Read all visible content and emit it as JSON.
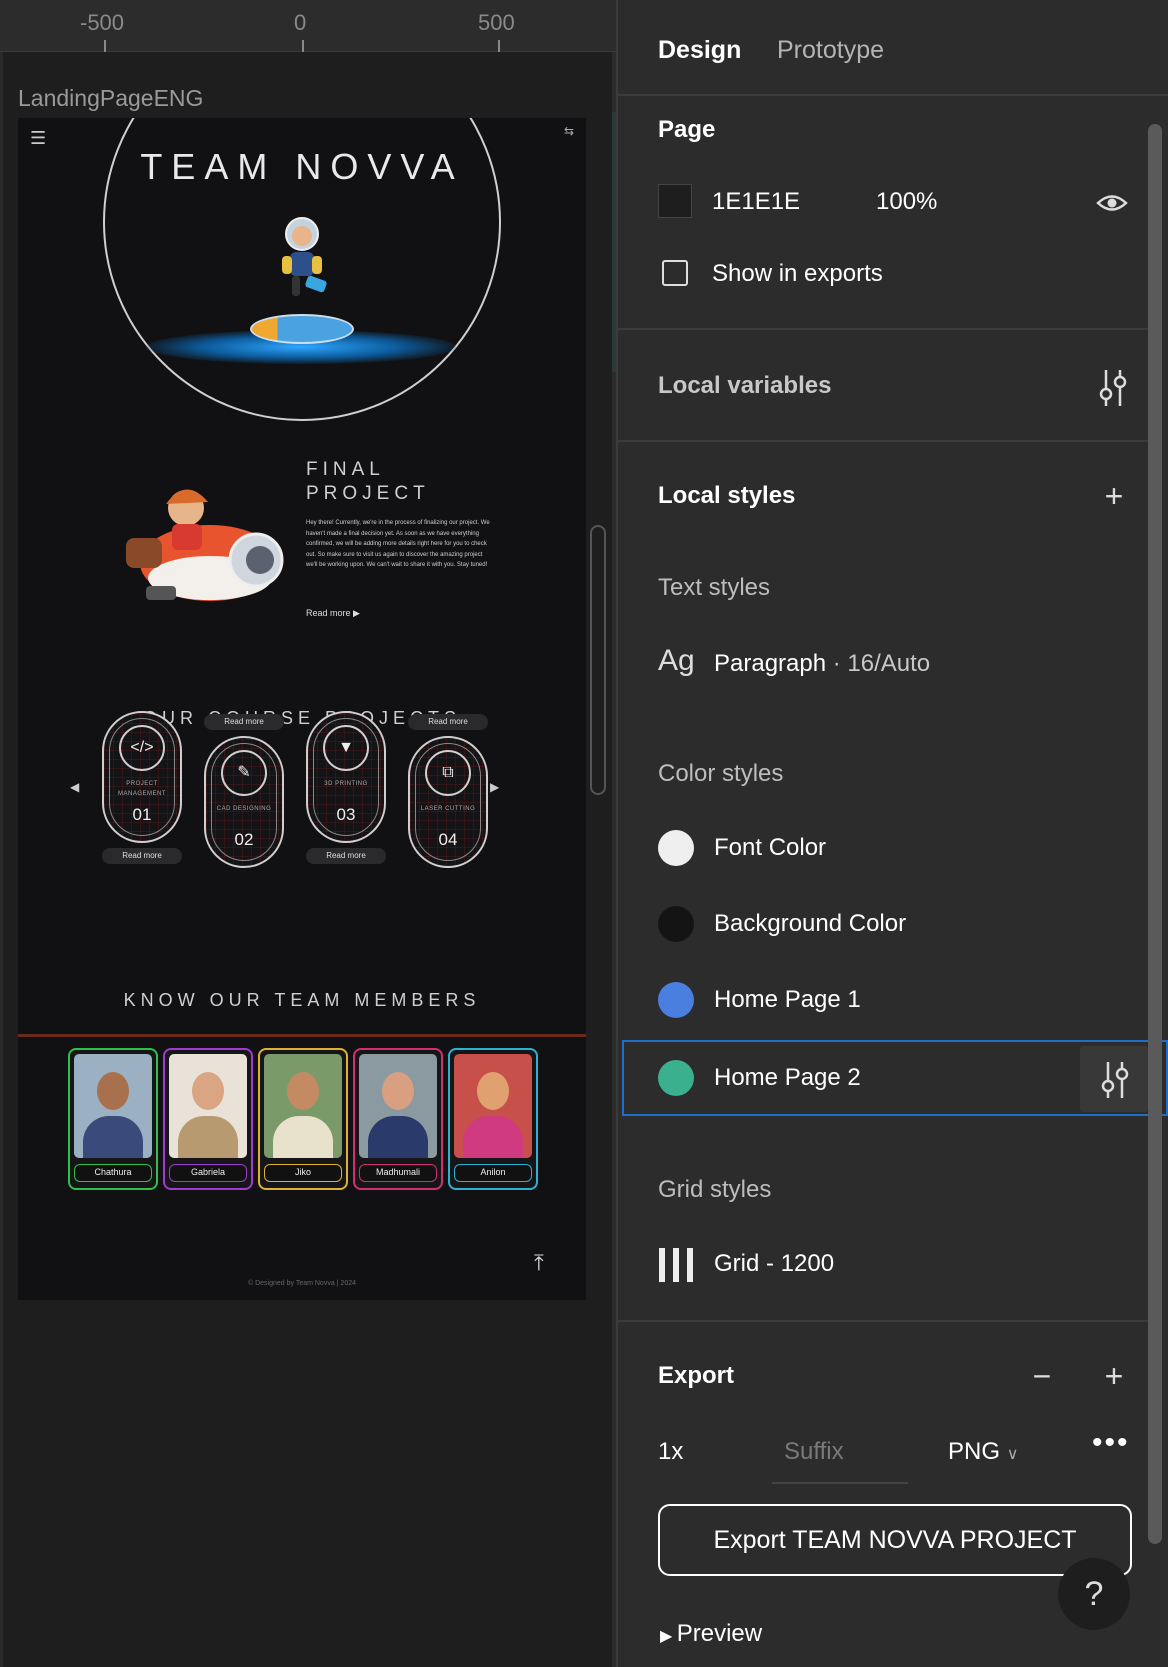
{
  "canvas": {
    "ruler": {
      "labels": [
        "-500",
        "0",
        "500"
      ]
    },
    "frame_name": "LandingPageENG",
    "site": {
      "hero_title": "TEAM NOVVA",
      "final_title_line1": "FINAL",
      "final_title_line2": "PROJECT",
      "final_text": "Hey there! Currently, we're in the process of finalizing our project. We haven't made a final decision yet. As soon as we have everything confirmed, we will be adding more details right here for you to check out. So make sure to visit us again to discover the amazing project we'll be working upon. We can't wait to share it with you. Stay tuned!",
      "read_more": "Read more",
      "course_title": "OUR COURSE PROJECTS",
      "courses": [
        {
          "icon": "code-icon",
          "glyph": "</>",
          "label": "PROJECT MANAGEMENT",
          "num": "01",
          "button": "Read more"
        },
        {
          "icon": "cad-icon",
          "glyph": "✎",
          "label": "CAD DESIGNING",
          "num": "02",
          "button": "Read more"
        },
        {
          "icon": "printer-3d-icon",
          "glyph": "▼",
          "label": "3D PRINTING",
          "num": "03",
          "button": "Read more"
        },
        {
          "icon": "laser-icon",
          "glyph": "⧉",
          "label": "LASER CUTTING",
          "num": "04",
          "button": "Read more"
        }
      ],
      "team_title": "KNOW OUR TEAM MEMBERS",
      "members": [
        {
          "name": "Chathura",
          "color": "#2fbf4a"
        },
        {
          "name": "Gabriela",
          "color": "#a03ad0"
        },
        {
          "name": "Jiko",
          "color": "#e0b030"
        },
        {
          "name": "Madhumali",
          "color": "#d03070"
        },
        {
          "name": "Anilon",
          "color": "#30b0d0"
        }
      ],
      "footer": "© Designed by Team Novva | 2024"
    }
  },
  "panel": {
    "tabs": {
      "design": "Design",
      "prototype": "Prototype"
    },
    "page": {
      "title": "Page",
      "color_hex": "1E1E1E",
      "opacity": "100%",
      "show_in_exports": "Show in exports"
    },
    "local_variables": "Local variables",
    "local_styles": {
      "title": "Local styles",
      "text_styles": "Text styles",
      "text_style_preview": "Ag",
      "text_style_name": "Paragraph",
      "text_style_meta": " · 16/Auto",
      "color_styles": "Color styles",
      "colors": [
        {
          "name": "Font Color",
          "hex": "#efefef"
        },
        {
          "name": "Background Color",
          "hex": "#141414"
        },
        {
          "name": "Home Page 1",
          "hex": "#4a7fe0"
        },
        {
          "name": "Home Page 2",
          "hex": "#3bb08f"
        }
      ],
      "grid_styles": "Grid styles",
      "grid_name": "Grid - 1200"
    },
    "export": {
      "title": "Export",
      "scale": "1x",
      "suffix_placeholder": "Suffix",
      "format": "PNG",
      "button": "Export TEAM NOVVA PROJECT",
      "preview": "Preview"
    },
    "help": "?"
  }
}
